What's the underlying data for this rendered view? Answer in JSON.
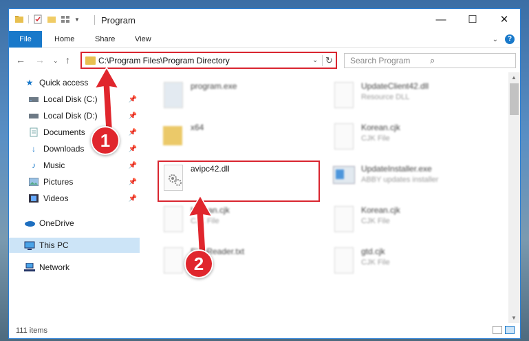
{
  "window": {
    "title": "Program"
  },
  "ribbon": {
    "tabs": [
      "File",
      "Home",
      "Share",
      "View"
    ]
  },
  "navbar": {
    "address": "C:\\Program Files\\Program Directory",
    "search_placeholder": "Search Program"
  },
  "sidebar": {
    "items": [
      {
        "label": "Quick access",
        "icon": "star-icon"
      },
      {
        "label": "Local Disk (C:)",
        "icon": "drive-icon",
        "pinned": true
      },
      {
        "label": "Local Disk (D:)",
        "icon": "drive-icon",
        "pinned": true
      },
      {
        "label": "Documents",
        "icon": "documents-icon",
        "pinned": true
      },
      {
        "label": "Downloads",
        "icon": "downloads-icon",
        "pinned": true
      },
      {
        "label": "Music",
        "icon": "music-icon",
        "pinned": true
      },
      {
        "label": "Pictures",
        "icon": "pictures-icon",
        "pinned": true
      },
      {
        "label": "Videos",
        "icon": "videos-icon",
        "pinned": true
      },
      {
        "label": "OneDrive",
        "icon": "onedrive-icon"
      },
      {
        "label": "This PC",
        "icon": "pc-icon",
        "selected": true
      },
      {
        "label": "Network",
        "icon": "network-icon"
      }
    ]
  },
  "files": [
    {
      "name": "program.exe",
      "sub": ""
    },
    {
      "name": "UpdateClient42.dll",
      "sub": "Resource DLL"
    },
    {
      "name": "x64",
      "sub": ""
    },
    {
      "name": "Korean.cjk",
      "sub": "CJK File"
    },
    {
      "name": "avipc42.dll",
      "sub": ""
    },
    {
      "name": "UpdateInstaller.exe",
      "sub": "ABBY updates installer"
    },
    {
      "name": "Korean.cjk",
      "sub": "CJK File"
    },
    {
      "name": "Korean.cjk",
      "sub": "CJK File"
    },
    {
      "name": "FineReader.txt",
      "sub": ""
    },
    {
      "name": "gtd.cjk",
      "sub": "CJK File"
    }
  ],
  "status": {
    "count": "111 items"
  },
  "callouts": {
    "one": "1",
    "two": "2"
  },
  "colors": {
    "accent": "#1979ca",
    "highlight": "#d9252f"
  }
}
